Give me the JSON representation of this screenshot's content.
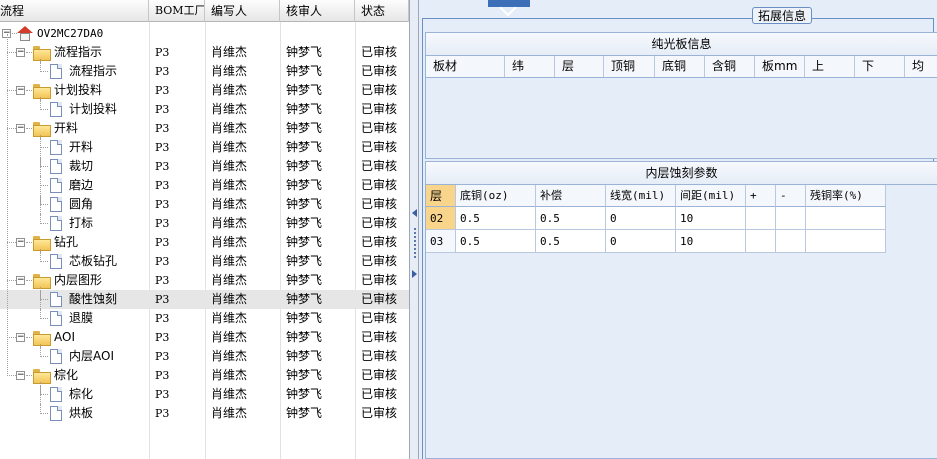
{
  "tree_grid": {
    "columns": [
      "流程",
      "BOM工厂",
      "编写人",
      "核审人",
      "状态"
    ],
    "root_label": "OV2MC27DA0",
    "rows": [
      {
        "label": "流程指示",
        "bom": "P3",
        "writer": "肖维杰",
        "reviewer": "钟梦飞",
        "status": "已审核"
      },
      {
        "label": "流程指示",
        "bom": "P3",
        "writer": "肖维杰",
        "reviewer": "钟梦飞",
        "status": "已审核"
      },
      {
        "label": "计划投料",
        "bom": "P3",
        "writer": "肖维杰",
        "reviewer": "钟梦飞",
        "status": "已审核"
      },
      {
        "label": "计划投料",
        "bom": "P3",
        "writer": "肖维杰",
        "reviewer": "钟梦飞",
        "status": "已审核"
      },
      {
        "label": "开料",
        "bom": "P3",
        "writer": "肖维杰",
        "reviewer": "钟梦飞",
        "status": "已审核"
      },
      {
        "label": "开料",
        "bom": "P3",
        "writer": "肖维杰",
        "reviewer": "钟梦飞",
        "status": "已审核"
      },
      {
        "label": "裁切",
        "bom": "P3",
        "writer": "肖维杰",
        "reviewer": "钟梦飞",
        "status": "已审核"
      },
      {
        "label": "磨边",
        "bom": "P3",
        "writer": "肖维杰",
        "reviewer": "钟梦飞",
        "status": "已审核"
      },
      {
        "label": "圆角",
        "bom": "P3",
        "writer": "肖维杰",
        "reviewer": "钟梦飞",
        "status": "已审核"
      },
      {
        "label": "打标",
        "bom": "P3",
        "writer": "肖维杰",
        "reviewer": "钟梦飞",
        "status": "已审核"
      },
      {
        "label": "钻孔",
        "bom": "P3",
        "writer": "肖维杰",
        "reviewer": "钟梦飞",
        "status": "已审核"
      },
      {
        "label": "芯板钻孔",
        "bom": "P3",
        "writer": "肖维杰",
        "reviewer": "钟梦飞",
        "status": "已审核"
      },
      {
        "label": "内层图形",
        "bom": "P3",
        "writer": "肖维杰",
        "reviewer": "钟梦飞",
        "status": "已审核"
      },
      {
        "label": "酸性蚀刻",
        "bom": "P3",
        "writer": "肖维杰",
        "reviewer": "钟梦飞",
        "status": "已审核"
      },
      {
        "label": "退膜",
        "bom": "P3",
        "writer": "肖维杰",
        "reviewer": "钟梦飞",
        "status": "已审核"
      },
      {
        "label": "AOI",
        "bom": "P3",
        "writer": "肖维杰",
        "reviewer": "钟梦飞",
        "status": "已审核"
      },
      {
        "label": "内层AOI",
        "bom": "P3",
        "writer": "肖维杰",
        "reviewer": "钟梦飞",
        "status": "已审核"
      },
      {
        "label": "棕化",
        "bom": "P3",
        "writer": "肖维杰",
        "reviewer": "钟梦飞",
        "status": "已审核"
      },
      {
        "label": "棕化",
        "bom": "P3",
        "writer": "肖维杰",
        "reviewer": "钟梦飞",
        "status": "已审核"
      },
      {
        "label": "烘板",
        "bom": "P3",
        "writer": "肖维杰",
        "reviewer": "钟梦飞",
        "status": "已审核"
      }
    ]
  },
  "ext_info": {
    "title": "拓展信息",
    "bare_board": {
      "title": "纯光板信息",
      "columns": [
        "板材",
        "纬",
        "层",
        "顶铜",
        "底铜",
        "含铜",
        "板mm",
        "上",
        "下",
        "均"
      ]
    },
    "etch_params": {
      "title": "内层蚀刻参数",
      "columns": [
        "层",
        "底铜(oz)",
        "补偿",
        "线宽(mil)",
        "间距(mil)",
        "+",
        "-",
        "残铜率(%)"
      ],
      "rows": [
        [
          "02",
          "0.5",
          "0.5",
          "0",
          "10",
          "",
          "",
          ""
        ],
        [
          "03",
          "0.5",
          "0.5",
          "0",
          "10",
          "",
          "",
          ""
        ]
      ]
    }
  },
  "colors": {
    "panel_bg": "#e5edf8",
    "selected_row_bg": "#e6e6e6",
    "highlight_cell_bg": "#f9d58c",
    "accent_blue": "#3c6fb7"
  },
  "icons": {
    "root": "home-icon",
    "group": "folder-icon",
    "leaf": "document-icon"
  }
}
